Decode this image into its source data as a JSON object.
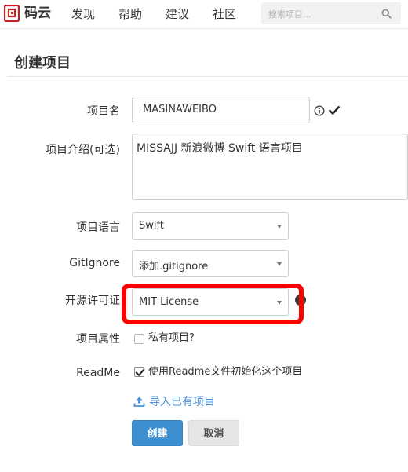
{
  "navbar": {
    "brand": "码云",
    "items": [
      "发现",
      "帮助",
      "建议",
      "社区"
    ],
    "search": {
      "placeholder": "搜索项目...",
      "value": ""
    }
  },
  "page": {
    "title": "创建项目"
  },
  "form": {
    "name": {
      "label": "项目名",
      "value": "MASINAWEIBO"
    },
    "description": {
      "label": "项目介绍(可选)",
      "value": "MISSAJJ 新浪微博  Swift 语言项目"
    },
    "language": {
      "label": "项目语言",
      "value": "Swift"
    },
    "gitignore": {
      "label": "GitIgnore",
      "value": "添加.gitignore"
    },
    "license": {
      "label": "开源许可证",
      "value": "MIT License"
    },
    "visibility": {
      "label": "项目属性",
      "checkbox_label": "私有项目?",
      "checked": false
    },
    "readme": {
      "label": "ReadMe",
      "checkbox_label": "使用Readme文件初始化这个项目",
      "checked": true
    },
    "import_link": "导入已有项目",
    "submit_label": "创建",
    "cancel_label": "取消"
  },
  "colors": {
    "accent": "#3d8fd0",
    "highlight": "#ff0000",
    "link": "#4a90d9"
  }
}
